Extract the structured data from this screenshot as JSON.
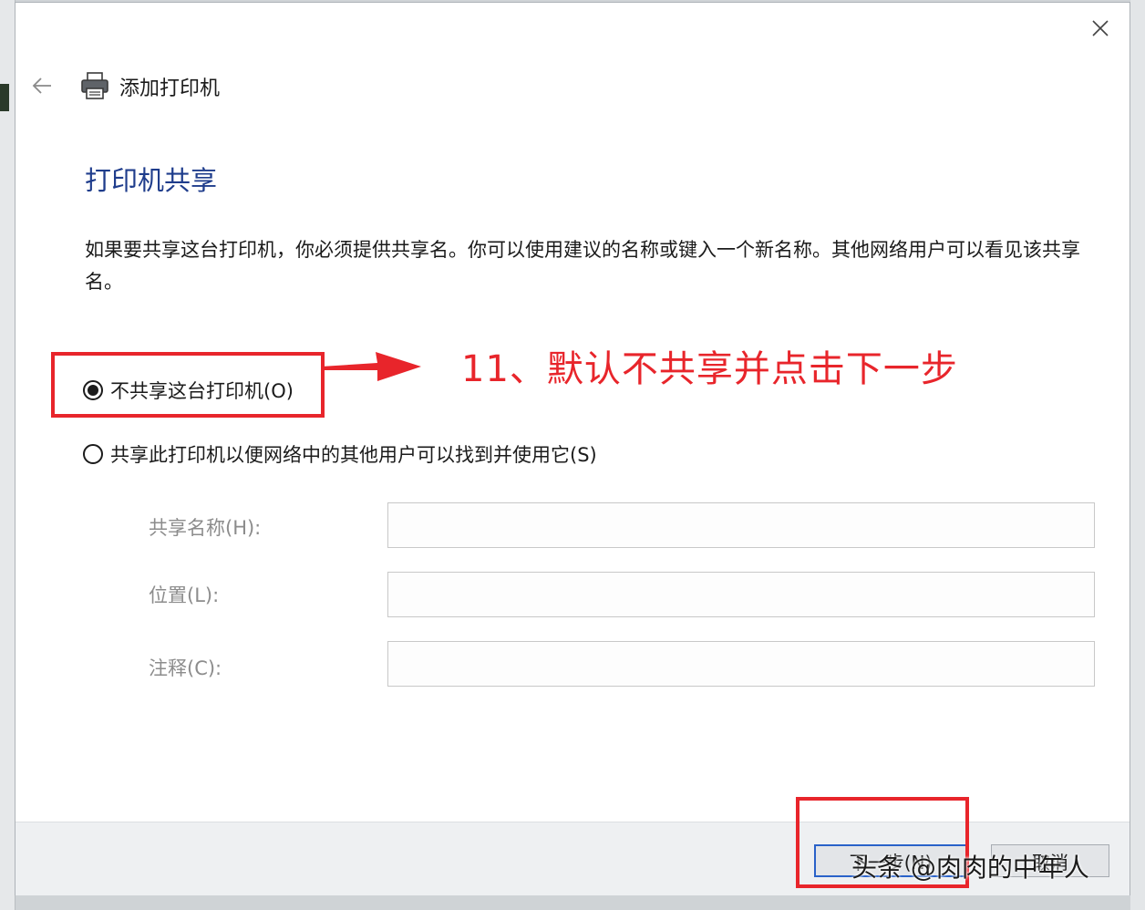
{
  "window": {
    "title": "添加打印机",
    "close_icon": "close-icon",
    "back_icon": "arrow-left-icon",
    "printer_icon": "printer-icon"
  },
  "page": {
    "title": "打印机共享",
    "description": "如果要共享这台打印机，你必须提供共享名。你可以使用建议的名称或键入一个新名称。其他网络用户可以看见该共享名。"
  },
  "options": {
    "no_share": {
      "label": "不共享这台打印机(O)",
      "selected": true
    },
    "share": {
      "label": "共享此打印机以便网络中的其他用户可以找到并使用它(S)",
      "selected": false
    }
  },
  "fields": {
    "share_name": {
      "label": "共享名称(H):",
      "value": ""
    },
    "location": {
      "label": "位置(L):",
      "value": ""
    },
    "comment": {
      "label": "注释(C):",
      "value": ""
    }
  },
  "buttons": {
    "next": "下一步(N)",
    "cancel": "取消"
  },
  "annotation": {
    "text": "11、默认不共享并点击下一步",
    "color": "#e8252b"
  },
  "watermark": "头条 @肉肉的中年人",
  "colors": {
    "title_blue": "#1f3d8c",
    "focus_border": "#2a62c9"
  }
}
